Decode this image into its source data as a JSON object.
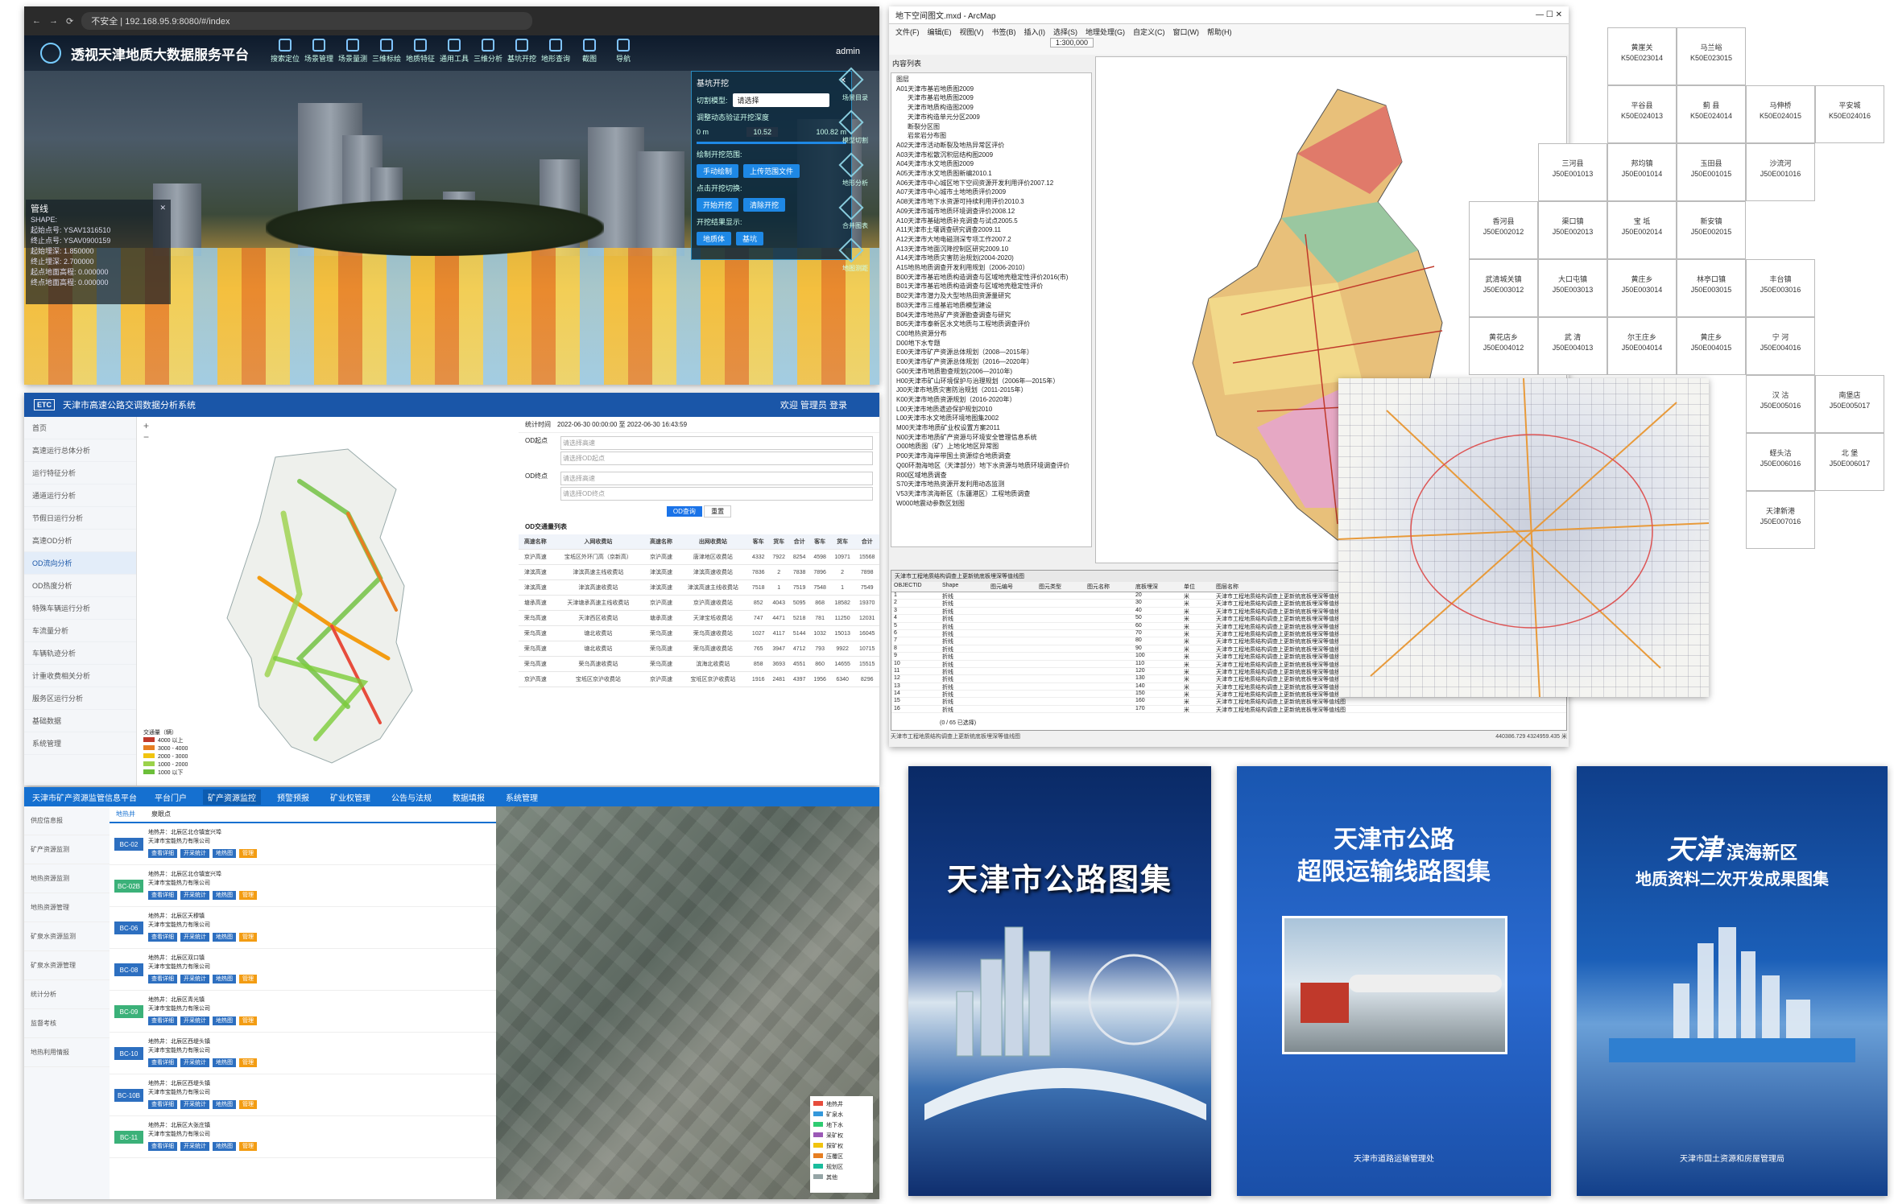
{
  "p1": {
    "url": "192.168.95.9:8080/#/index",
    "url_prefix": "不安全",
    "title": "透视天津地质大数据服务平台",
    "menu": [
      "搜索定位",
      "场景管理",
      "场景量测",
      "三维标绘",
      "地质特征",
      "通用工具",
      "三维分析",
      "基坑开挖",
      "地形查询",
      "截图",
      "导航"
    ],
    "user": "admin",
    "dialog": {
      "title": "基坑开挖",
      "mode_label": "切割模型:",
      "mode_value": "请选择",
      "hint": "调整动态验证开挖深度",
      "depth_min": "0 m",
      "depth_value": "10.52",
      "depth_max": "100.82 m",
      "draw_label": "绘制开挖范围:",
      "draw_btn1": "手动绘制",
      "draw_btn2": "上传范围文件",
      "section_label": "点击开挖切换:",
      "section_btn1": "开始开挖",
      "section_btn2": "清除开挖",
      "show_label": "开挖结果显示:",
      "show_btn1": "地质体",
      "show_btn2": "基坑"
    },
    "info": {
      "title": "管线",
      "lines": [
        "SHAPE:",
        "起始点号: YSAV1316510",
        "终止点号: YSAV0900159",
        "起始埋深: 1.850000",
        "终止埋深: 2.700000",
        "起点地面高程: 0.000000",
        "终点地面高程: 0.000000"
      ]
    },
    "tools": [
      "场景目录",
      "模型切割",
      "地形分析",
      "合并图表",
      "地图测距"
    ]
  },
  "p2": {
    "title": "天津市高速公路交调数据分析系统",
    "logo": "ETC",
    "user": "欢迎 管理员 登录",
    "side": [
      "首页",
      "高速运行总体分析",
      "运行特征分析",
      "通道运行分析",
      "节假日运行分析",
      "高速OD分析",
      "OD流向分析",
      "OD热度分析",
      "特殊车辆运行分析",
      "车流量分析",
      "车辆轨迹分析",
      "计重收费相关分析",
      "服务区运行分析",
      "基础数据",
      "系统管理"
    ],
    "stat_time_label": "统计时间",
    "stat_time": "2022-06-30 00:00:00  至  2022-06-30 16:43:59",
    "od_start": "OD起点",
    "od_end": "OD终点",
    "placeholder1": "请选择高速",
    "placeholder2": "请选择OD起点",
    "placeholder3": "请选择高速",
    "placeholder4": "请选择OD终点",
    "query_btn": "OD查询",
    "reset_btn": "重置",
    "table_title": "OD交通量列表",
    "columns": [
      "高速名称",
      "入网收费站",
      "高速名称",
      "出网收费站",
      "客车",
      "货车",
      "合计",
      "客车",
      "货车",
      "合计"
    ],
    "rows": [
      [
        "京沪高速",
        "宝坻区外环门高（京新高）",
        "京沪高速",
        "唐津地区收费站",
        "4332",
        "7922",
        "8254",
        "4598",
        "10971",
        "15568"
      ],
      [
        "津滨高速",
        "津滨高速主线收费站",
        "津滨高速",
        "津滨高速收费站",
        "7836",
        "2",
        "7838",
        "7896",
        "2",
        "7898"
      ],
      [
        "津滨高速",
        "津滨高速收费站",
        "津滨高速",
        "津滨高速主线收费站",
        "7518",
        "1",
        "7519",
        "7548",
        "1",
        "7549"
      ],
      [
        "塘承高速",
        "天津塘承高速主线收费站",
        "京沪高速",
        "京沪高速收费站",
        "852",
        "4043",
        "5095",
        "868",
        "18582",
        "19370"
      ],
      [
        "荣乌高速",
        "天津西区收费站",
        "塘承高速",
        "天津宝坻收费站",
        "747",
        "4471",
        "5218",
        "781",
        "11250",
        "12031"
      ],
      [
        "荣乌高速",
        "塘北收费站",
        "荣乌高速",
        "荣乌高速收费站",
        "1027",
        "4117",
        "5144",
        "1032",
        "15013",
        "16045"
      ],
      [
        "荣乌高速",
        "塘北收费站",
        "荣乌高速",
        "荣乌高速收费站",
        "765",
        "3947",
        "4712",
        "793",
        "9922",
        "10715"
      ],
      [
        "荣乌高速",
        "荣乌高速收费站",
        "荣乌高速",
        "滨海北收费站",
        "858",
        "3693",
        "4551",
        "860",
        "14655",
        "15515"
      ],
      [
        "京沪高速",
        "宝坻区京沪收费站",
        "京沪高速",
        "宝坻区京沪收费站",
        "1916",
        "2481",
        "4397",
        "1956",
        "6340",
        "8296"
      ]
    ],
    "legend_title": "交通量（辆）",
    "legend": [
      "4000 以上",
      "3000 - 4000",
      "2000 - 3000",
      "1000 - 2000",
      "1000 以下"
    ]
  },
  "p3": {
    "title": "天津市矿产资源监管信息平台",
    "nav": [
      "平台门户",
      "矿产资源监控",
      "预警预报",
      "矿业权管理",
      "公告与法规",
      "数据填报",
      "系统管理"
    ],
    "side": [
      "供应信息报",
      "矿产资源监测",
      "地热资源监测",
      "地热资源管理",
      "矿泉水资源监测",
      "矿泉水资源管理",
      "统计分析",
      "监督考核",
      "地热利用情报"
    ],
    "tab1": "地热井",
    "tab2": "泉眼点",
    "items": [
      {
        "tag": "BC-02",
        "name": "地热井：北辰区北仓镇宜兴埠",
        "owner": "天津市宝能热力有限公司"
      },
      {
        "tag": "BC-02B",
        "name": "地热井：北辰区北仓镇宜兴埠",
        "owner": "天津市宝能热力有限公司"
      },
      {
        "tag": "BC-06",
        "name": "地热井：北辰区天穆镇",
        "owner": "天津市宝能热力有限公司"
      },
      {
        "tag": "BC-08",
        "name": "地热井：北辰区双口镇",
        "owner": "天津市宝能热力有限公司"
      },
      {
        "tag": "BC-09",
        "name": "地热井：北辰区青光镇",
        "owner": "天津市宝能热力有限公司"
      },
      {
        "tag": "BC-10",
        "name": "地热井：北辰区西堤头镇",
        "owner": "天津市宝能热力有限公司"
      },
      {
        "tag": "BC-10B",
        "name": "地热井：北辰区西堤头镇",
        "owner": "天津市宝能热力有限公司"
      },
      {
        "tag": "BC-11",
        "name": "地热井：北辰区大张庄镇",
        "owner": "天津市宝能热力有限公司"
      }
    ],
    "btns": [
      "查看详细",
      "开采统计",
      "地热图",
      "管理"
    ],
    "legend": [
      "地热井",
      "矿泉水",
      "地下水",
      "采矿权",
      "探矿权",
      "压覆区",
      "规划区",
      "其他"
    ]
  },
  "p4": {
    "title": "地下空间图文.mxd - ArcMap",
    "menus": [
      "文件(F)",
      "编辑(E)",
      "视图(V)",
      "书签(B)",
      "插入(I)",
      "选择(S)",
      "地理处理(G)",
      "自定义(C)",
      "窗口(W)",
      "帮助(H)"
    ],
    "scale": "1:300,000",
    "toc_header": "内容列表",
    "layers": [
      "图层",
      "A01天津市基岩地质图2009",
      "天津市基岩地质图2009",
      "天津市地质构造图2009",
      "天津市构造单元分区2009",
      "断裂分区图",
      "岩浆岩分布图",
      "A02天津市活动断裂及地热异常区评价",
      "A03天津市松散沉积层结构图2009",
      "A04天津市水文地质图2009",
      "A05天津市水文地质图新编2010.1",
      "A06天津市中心城区地下空间资源开发利用评价2007.12",
      "A07天津市中心城市土地地质评价2009",
      "A08天津市地下水资源可持续利用评价2010.3",
      "A09天津市城市地质环境调查评价2008.12",
      "A10天津市基础地质补充调查与试点2005.5",
      "A11天津市土壤调查研究调查2009.11",
      "A12天津市大地电磁测深专项工作2007.2",
      "A13天津市地面沉降控制区研究2009.10",
      "A14天津市地质灾害防治规划(2004-2020)",
      "A15地热地质调查开发利用规划（2006-2010）",
      "B00天津市基岩地质构造调查与区域地壳稳定性评价2016(市)",
      "B01天津市基岩地质构造调查与区域地壳稳定性评价",
      "B02天津市潜力及大型地热田资源量研究",
      "B03天津市三维基岩地质模型建设",
      "B04天津市地热矿产资源勘查调查与研究",
      "B05天津市泰新区水文地质与工程地质调查评价",
      "C00地热资源分布",
      "D00地下水专题",
      "E00天津市矿产资源总体规划（2008—2015年）",
      "E00天津市矿产资源总体规划（2016—2020年）",
      "G00天津市地质勘查规划(2006—2010年)",
      "H00天津市矿山环境保护与治理规划（2006年—2015年）",
      "J00天津市地质灾害防治规划（2011-2015年）",
      "K00天津市地质资源规划（2016-2020年）",
      "L00天津市地质遗迹保护规划2010",
      "L00天津市水文地质环境地图集2002",
      "M00天津市地质矿业权设置方案2011",
      "N00天津市地质矿产资源与环境安全管理信息系统",
      "O00地质图（矿）上地化地区异常图",
      "P00天津市海岸带国土资源综合地质调查",
      "Q00环渤海地区（天津部分）地下水资源与地质环境调查评价",
      "R00区域地质调查",
      "S70天津市地热资源开发利用动态监测",
      "V53天津市滨海新区（东疆港区）工程地质调查",
      "W000地震动参数区划图"
    ],
    "table_title": "天津市工程地质结构调查上更新统底板埋深等值线图",
    "attr_columns": [
      "OBJECTID",
      "Shape",
      "图元编号",
      "图元类型",
      "图元名称",
      "底板埋深",
      "单位",
      "图层名称"
    ],
    "attr_rows": [
      [
        "1",
        "折线",
        "",
        "",
        "",
        "20",
        "米",
        "天津市工程地质结构调查上更新统底板埋深等值线图"
      ],
      [
        "2",
        "折线",
        "",
        "",
        "",
        "30",
        "米",
        "天津市工程地质结构调查上更新统底板埋深等值线图"
      ],
      [
        "3",
        "折线",
        "",
        "",
        "",
        "40",
        "米",
        "天津市工程地质结构调查上更新统底板埋深等值线图"
      ],
      [
        "4",
        "折线",
        "",
        "",
        "",
        "50",
        "米",
        "天津市工程地质结构调查上更新统底板埋深等值线图"
      ],
      [
        "5",
        "折线",
        "",
        "",
        "",
        "60",
        "米",
        "天津市工程地质结构调查上更新统底板埋深等值线图"
      ],
      [
        "6",
        "折线",
        "",
        "",
        "",
        "70",
        "米",
        "天津市工程地质结构调查上更新统底板埋深等值线图"
      ],
      [
        "7",
        "折线",
        "",
        "",
        "",
        "80",
        "米",
        "天津市工程地质结构调查上更新统底板埋深等值线图"
      ],
      [
        "8",
        "折线",
        "",
        "",
        "",
        "90",
        "米",
        "天津市工程地质结构调查上更新统底板埋深等值线图"
      ],
      [
        "9",
        "折线",
        "",
        "",
        "",
        "100",
        "米",
        "天津市工程地质结构调查上更新统底板埋深等值线图"
      ],
      [
        "10",
        "折线",
        "",
        "",
        "",
        "110",
        "米",
        "天津市工程地质结构调查上更新统底板埋深等值线图"
      ],
      [
        "11",
        "折线",
        "",
        "",
        "",
        "120",
        "米",
        "天津市工程地质结构调查上更新统底板埋深等值线图"
      ],
      [
        "12",
        "折线",
        "",
        "",
        "",
        "130",
        "米",
        "天津市工程地质结构调查上更新统底板埋深等值线图"
      ],
      [
        "13",
        "折线",
        "",
        "",
        "",
        "140",
        "米",
        "天津市工程地质结构调查上更新统底板埋深等值线图"
      ],
      [
        "14",
        "折线",
        "",
        "",
        "",
        "150",
        "米",
        "天津市工程地质结构调查上更新统底板埋深等值线图"
      ],
      [
        "15",
        "折线",
        "",
        "",
        "",
        "160",
        "米",
        "天津市工程地质结构调查上更新统底板埋深等值线图"
      ],
      [
        "16",
        "折线",
        "",
        "",
        "",
        "170",
        "米",
        "天津市工程地质结构调查上更新统底板埋深等值线图"
      ]
    ],
    "record_count": "(0 / 65 已选择)",
    "tabs": "天津市工程地质结构调查上更新统底板埋深等值线图",
    "coords": "440386.729  4324959.435 米"
  },
  "sheets": [
    {
      "name": "黄崖关",
      "code": "K50E023014"
    },
    {
      "name": "马兰峪",
      "code": "K50E023015"
    },
    {
      "name": "平谷县",
      "code": "K50E024013"
    },
    {
      "name": "蓟 县",
      "code": "K50E024014"
    },
    {
      "name": "马伸桥",
      "code": "K50E024015"
    },
    {
      "name": "平安城",
      "code": "K50E024016"
    },
    {
      "name": "三河县",
      "code": "J50E001013"
    },
    {
      "name": "邦均镇",
      "code": "J50E001014"
    },
    {
      "name": "玉田县",
      "code": "J50E001015"
    },
    {
      "name": "沙流河",
      "code": "J50E001016"
    },
    {
      "name": "香河县",
      "code": "J50E002012"
    },
    {
      "name": "渠口镇",
      "code": "J50E002013"
    },
    {
      "name": "宝 坻",
      "code": "J50E002014"
    },
    {
      "name": "新安镇",
      "code": "J50E002015"
    },
    {
      "name": "武清城关镇",
      "code": "J50E003012"
    },
    {
      "name": "大口屯镇",
      "code": "J50E003013"
    },
    {
      "name": "黄庄乡",
      "code": "J50E003014"
    },
    {
      "name": "林亭口镇",
      "code": "J50E003015"
    },
    {
      "name": "丰台镇",
      "code": "J50E003016"
    },
    {
      "name": "黄花店乡",
      "code": "J50E004012"
    },
    {
      "name": "武 清",
      "code": "J50E004013"
    },
    {
      "name": "尔王庄乡",
      "code": "J50E004014"
    },
    {
      "name": "黄庄乡",
      "code": "J50E004015"
    },
    {
      "name": "宁 河",
      "code": "J50E004016"
    },
    {
      "name": "汉 沽",
      "code": "J50E005016"
    },
    {
      "name": "南堡店",
      "code": "J50E005017"
    },
    {
      "name": "蛏头沽",
      "code": "J50E006016"
    },
    {
      "name": "北 堡",
      "code": "J50E006017"
    },
    {
      "name": "天津新港",
      "code": "J50E007016"
    }
  ],
  "covers": {
    "c1": {
      "title": "天津市公路图集"
    },
    "c2": {
      "title1": "天津市公路",
      "title2": "超限运输线路图集",
      "foot": "天津市道路运输管理处"
    },
    "c3": {
      "title1": "天津",
      "title1b": "滨海新区",
      "title2": "地质资料二次开发成果图集",
      "foot": "天津市国土资源和房屋管理局"
    }
  }
}
